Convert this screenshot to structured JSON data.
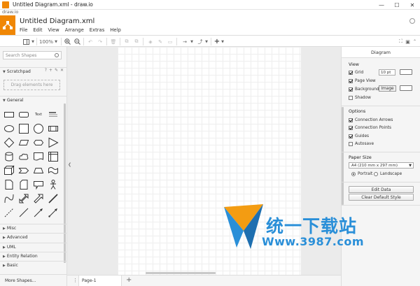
{
  "window": {
    "title": "Untitled Diagram.xml - draw.io",
    "address": "draw.io",
    "controls": [
      "—",
      "☐",
      "✕"
    ]
  },
  "header": {
    "doc_title": "Untitled Diagram.xml",
    "menu": [
      "File",
      "Edit",
      "View",
      "Arrange",
      "Extras",
      "Help"
    ]
  },
  "toolbar": {
    "zoom": "100%"
  },
  "sidebar": {
    "search_placeholder": "Search Shapes",
    "scratchpad": "Scratchpad",
    "scratchpad_icons": [
      "?",
      "+",
      "✎",
      "✕"
    ],
    "drag_hint": "Drag elements here",
    "general": "General",
    "text_shape_label": "Text",
    "sections": [
      "Misc",
      "Advanced",
      "UML",
      "Entity Relation",
      "Basic"
    ],
    "more_shapes": "More Shapes..."
  },
  "pages": {
    "tab": "Page-1",
    "add": "+"
  },
  "format_panel": {
    "title": "Diagram",
    "view_header": "View",
    "grid_label": "Grid",
    "grid_size": "10 pt",
    "page_view_label": "Page View",
    "background_label": "Background",
    "image_button": "Image",
    "shadow_label": "Shadow",
    "options_header": "Options",
    "connection_arrows": "Connection Arrows",
    "connection_points": "Connection Points",
    "guides": "Guides",
    "autosave": "Autosave",
    "paper_size_header": "Paper Size",
    "paper_size": "A4 (210 mm x 297 mm)",
    "portrait": "Portrait",
    "landscape": "Landscape",
    "edit_data": "Edit Data",
    "clear_default_style": "Clear Default Style"
  },
  "watermark": {
    "cn": "统一下载站",
    "url": "Www.3987.com"
  },
  "colors": {
    "brand": "#f08705",
    "watermark_blue": "#2a8fd8"
  }
}
